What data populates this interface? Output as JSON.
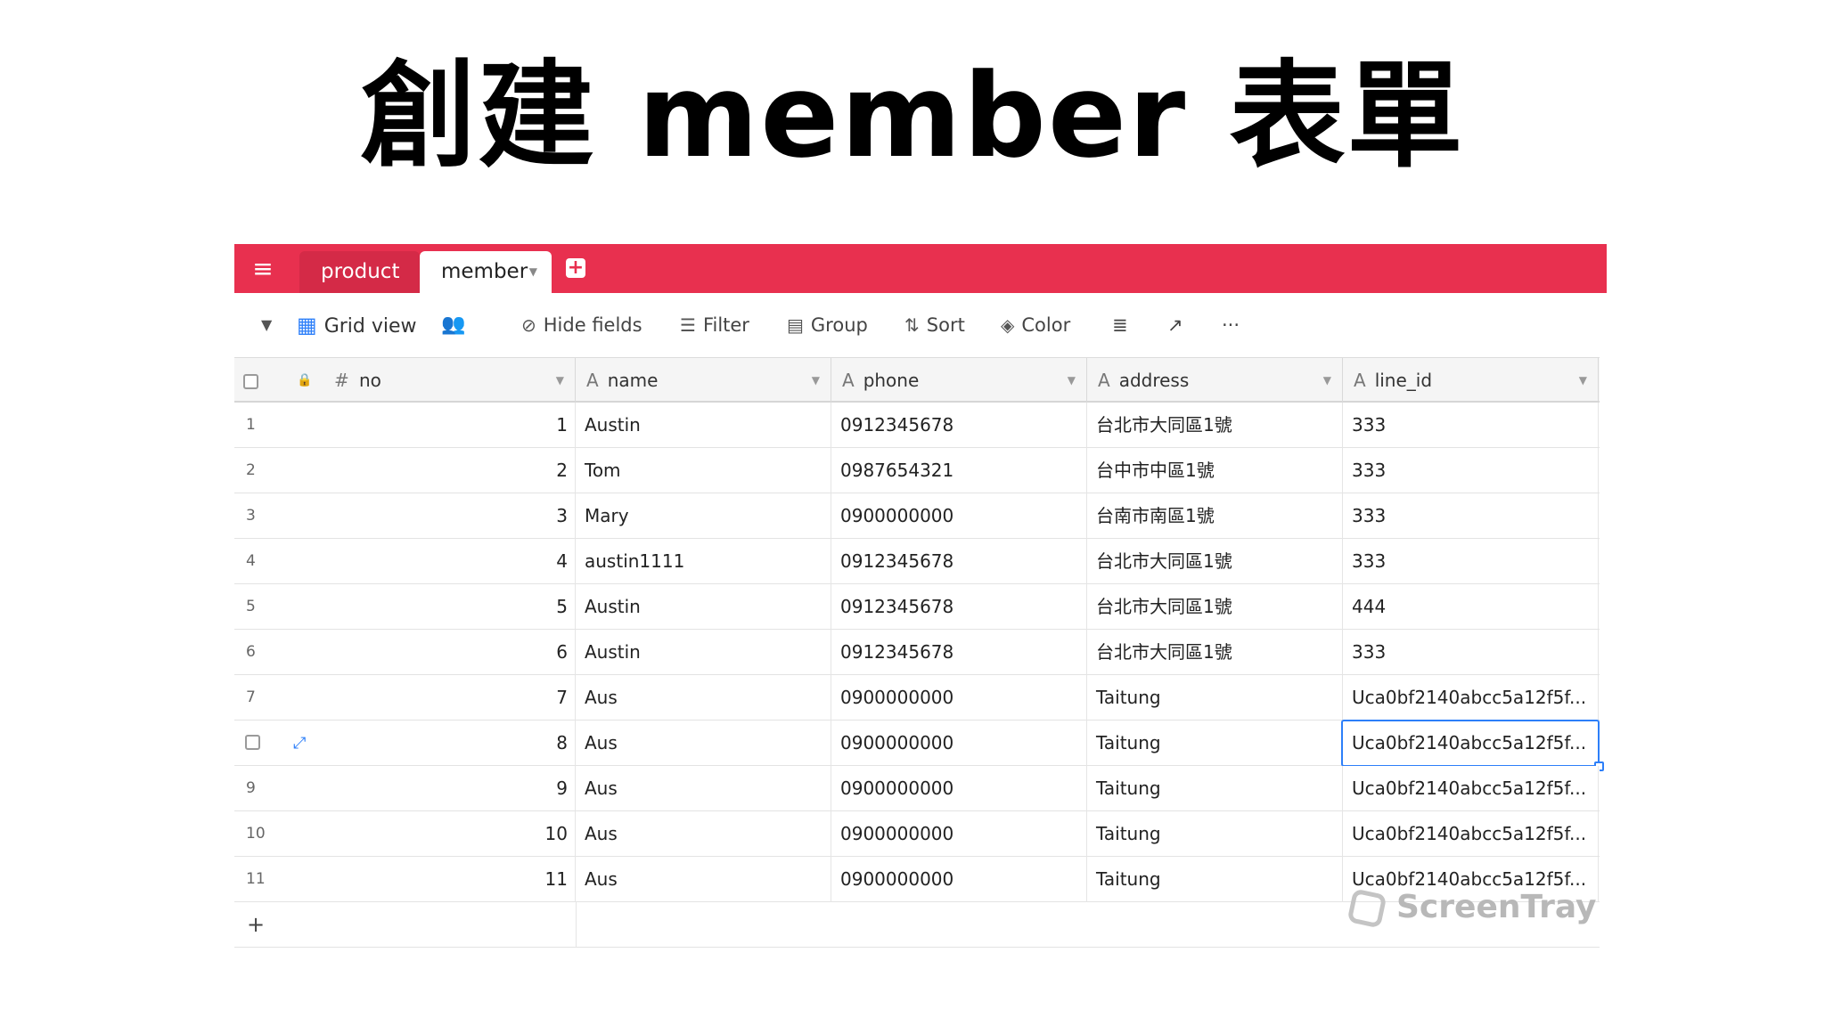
{
  "title": "創建 member 表單",
  "tabs": {
    "product": "product",
    "member": "member"
  },
  "toolbar": {
    "grid_view": "Grid view",
    "hide_fields": "Hide fields",
    "filter": "Filter",
    "group": "Group",
    "sort": "Sort",
    "color": "Color"
  },
  "columns": {
    "no": "no",
    "name": "name",
    "phone": "phone",
    "address": "address",
    "line_id": "line_id"
  },
  "rows": [
    {
      "index": "1",
      "no": "1",
      "name": "Austin",
      "phone": "0912345678",
      "address": "台北市大同區1號",
      "line_id": "333"
    },
    {
      "index": "2",
      "no": "2",
      "name": "Tom",
      "phone": "0987654321",
      "address": "台中市中區1號",
      "line_id": "333"
    },
    {
      "index": "3",
      "no": "3",
      "name": "Mary",
      "phone": "0900000000",
      "address": "台南市南區1號",
      "line_id": "333"
    },
    {
      "index": "4",
      "no": "4",
      "name": "austin1111",
      "phone": "0912345678",
      "address": "台北市大同區1號",
      "line_id": "333"
    },
    {
      "index": "5",
      "no": "5",
      "name": "Austin",
      "phone": "0912345678",
      "address": "台北市大同區1號",
      "line_id": "444"
    },
    {
      "index": "6",
      "no": "6",
      "name": "Austin",
      "phone": "0912345678",
      "address": "台北市大同區1號",
      "line_id": "333"
    },
    {
      "index": "7",
      "no": "7",
      "name": "Aus",
      "phone": "0900000000",
      "address": "Taitung",
      "line_id": "Uca0bf2140abcc5a12f5f..."
    },
    {
      "index": "8",
      "no": "8",
      "name": "Aus",
      "phone": "0900000000",
      "address": "Taitung",
      "line_id": "Uca0bf2140abcc5a12f5f..."
    },
    {
      "index": "9",
      "no": "9",
      "name": "Aus",
      "phone": "0900000000",
      "address": "Taitung",
      "line_id": "Uca0bf2140abcc5a12f5f..."
    },
    {
      "index": "10",
      "no": "10",
      "name": "Aus",
      "phone": "0900000000",
      "address": "Taitung",
      "line_id": "Uca0bf2140abcc5a12f5f..."
    },
    {
      "index": "11",
      "no": "11",
      "name": "Aus",
      "phone": "0900000000",
      "address": "Taitung",
      "line_id": "Uca0bf2140abcc5a12f5f..."
    }
  ],
  "add_row": "+",
  "watermark": "ScreenTray",
  "colors": {
    "accent": "#e8304f",
    "selection": "#2d7ff9"
  }
}
